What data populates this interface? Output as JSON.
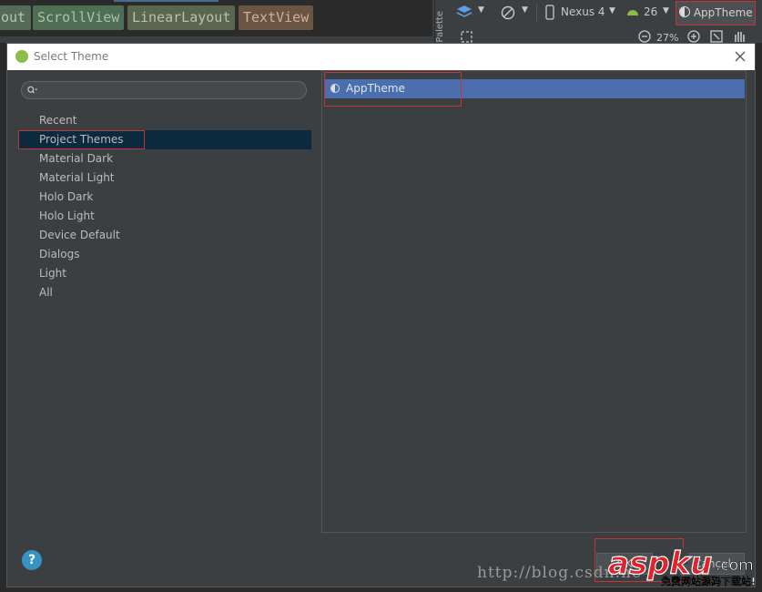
{
  "editor": {
    "xml_tags": [
      "out",
      "ScrollView",
      "LinearLayout",
      "TextView"
    ]
  },
  "palette": {
    "label": "Palette"
  },
  "layout_toolbar": {
    "device": "Nexus 4",
    "api_level": "26",
    "theme": "AppTheme",
    "zoom": "27%"
  },
  "dialog": {
    "title": "Select Theme",
    "search": {
      "value": "",
      "placeholder": ""
    },
    "categories": [
      "Recent",
      "Project Themes",
      "Material Dark",
      "Material Light",
      "Holo Dark",
      "Holo Light",
      "Device Default",
      "Dialogs",
      "Light",
      "All"
    ],
    "selected_category": "Project Themes",
    "themes": [
      "AppTheme"
    ],
    "selected_theme": "AppTheme",
    "help_label": "?",
    "ok_label": "OK",
    "cancel_label": "Cancel"
  },
  "watermark": {
    "url": "http://blog.csdn.ne",
    "brand": "aspku",
    "brand_suffix": ".com",
    "tagline": "免费网站源码下载站!"
  },
  "colors": {
    "selection_blue": "#4b6eaf",
    "category_selected": "#0d293e",
    "highlight_outline": "#c6333a",
    "watermark_red": "#e0232c"
  }
}
